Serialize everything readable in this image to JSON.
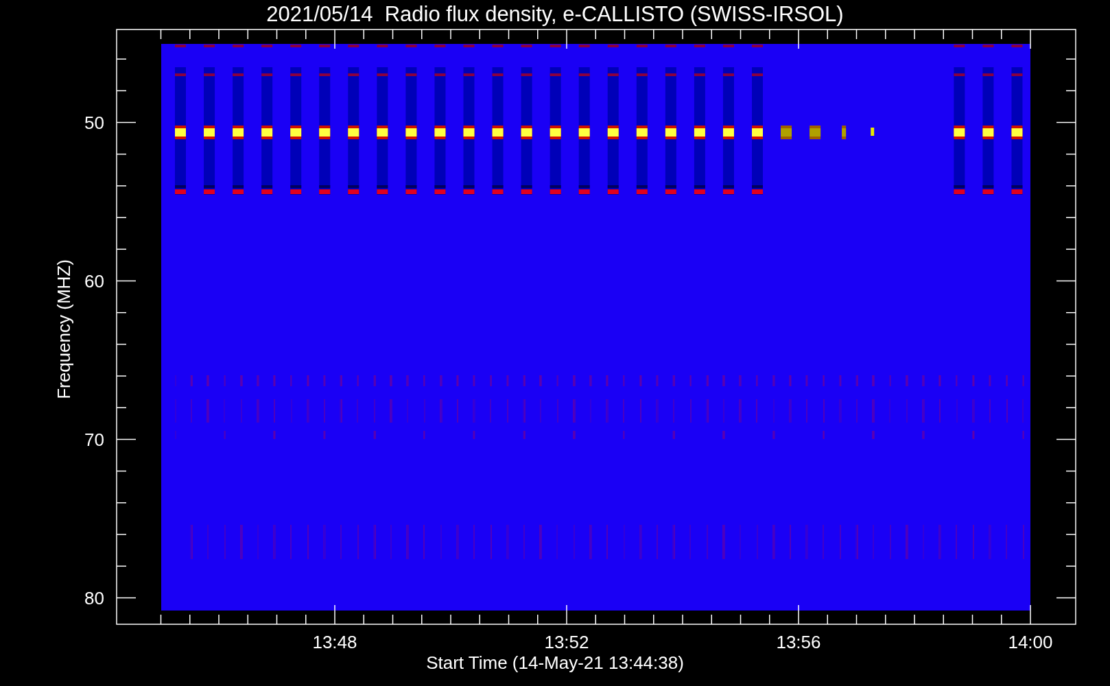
{
  "title": "2021/05/14  Radio flux density, e-CALLISTO (SWISS-IRSOL)",
  "ylabel": "Frequency (MHZ)",
  "yticks": [
    {
      "label": "50"
    },
    {
      "label": "60"
    },
    {
      "label": "70"
    },
    {
      "label": "80"
    }
  ],
  "xticks": [
    {
      "label": "13:48"
    },
    {
      "label": "13:52"
    },
    {
      "label": "13:56"
    },
    {
      "label": "14:00"
    }
  ],
  "xlabel": "Start Time (14-May-21 13:44:38)"
}
